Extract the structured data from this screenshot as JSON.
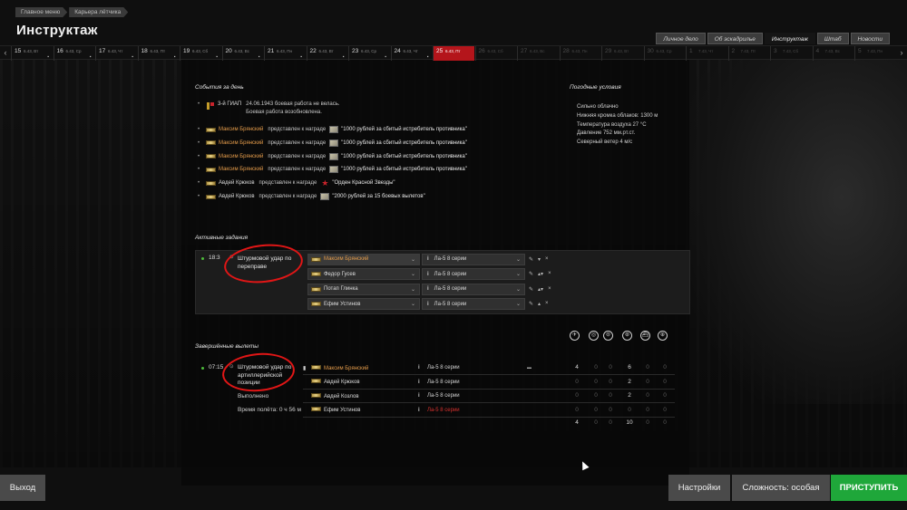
{
  "breadcrumb": [
    "Главное меню",
    "Карьера лётчика"
  ],
  "title": "Инструктаж",
  "top_tabs": [
    {
      "label": "Личное дело",
      "active": false
    },
    {
      "label": "Об эскадрилье",
      "active": false
    },
    {
      "label": "Инструктаж",
      "active": true
    },
    {
      "label": "Штаб",
      "active": false
    },
    {
      "label": "Новости",
      "active": false
    }
  ],
  "timeline": {
    "prev_icon": "‹",
    "next_icon": "›",
    "days": [
      {
        "num": "15",
        "sub": "6.43, Вт",
        "state": "past"
      },
      {
        "num": "16",
        "sub": "6.43, Ср",
        "state": "past"
      },
      {
        "num": "17",
        "sub": "6.43, Чт",
        "state": "past"
      },
      {
        "num": "18",
        "sub": "6.43, Пт",
        "state": "past"
      },
      {
        "num": "19",
        "sub": "6.43, Сб",
        "state": "past"
      },
      {
        "num": "20",
        "sub": "6.43, Вс",
        "state": "past"
      },
      {
        "num": "21",
        "sub": "6.43, Пн",
        "state": "past"
      },
      {
        "num": "22",
        "sub": "6.43, Вт",
        "state": "past"
      },
      {
        "num": "23",
        "sub": "6.43, Ср",
        "state": "past"
      },
      {
        "num": "24",
        "sub": "6.43, Чт",
        "state": "past"
      },
      {
        "num": "25",
        "sub": "6.43, Пт",
        "state": "current"
      },
      {
        "num": "26",
        "sub": "6.43, Сб",
        "state": "future"
      },
      {
        "num": "27",
        "sub": "6.43, Вс",
        "state": "future"
      },
      {
        "num": "28",
        "sub": "6.43, Пн",
        "state": "future"
      },
      {
        "num": "29",
        "sub": "6.43, Вт",
        "state": "future"
      },
      {
        "num": "30",
        "sub": "6.43, Ср",
        "state": "future"
      },
      {
        "num": "1",
        "sub": "7.43, Чт",
        "state": "future"
      },
      {
        "num": "2",
        "sub": "7.43, Пт",
        "state": "future"
      },
      {
        "num": "3",
        "sub": "7.43, Сб",
        "state": "future"
      },
      {
        "num": "4",
        "sub": "7.43, Вс",
        "state": "future"
      },
      {
        "num": "5",
        "sub": "7.43, Пн",
        "state": "future"
      }
    ]
  },
  "events": {
    "title": "События за день",
    "unit_event": {
      "unit": "3-й ГИАП",
      "line1": "24.06.1943 боевая работа не велась.",
      "line2": "Боевая работа возобновлена."
    },
    "items": [
      {
        "name": "Максим Брянский",
        "highlight": true,
        "action": "представлен к награде",
        "award": "\"1000 рублей за сбитый истребитель противника\"",
        "icon": "money"
      },
      {
        "name": "Максим Брянский",
        "highlight": true,
        "action": "представлен к награде",
        "award": "\"1000 рублей за сбитый истребитель противника\"",
        "icon": "money"
      },
      {
        "name": "Максим Брянский",
        "highlight": true,
        "action": "представлен к награде",
        "award": "\"1000 рублей за сбитый истребитель противника\"",
        "icon": "money"
      },
      {
        "name": "Максим Брянский",
        "highlight": true,
        "action": "представлен к награде",
        "award": "\"1000 рублей за сбитый истребитель противника\"",
        "icon": "money"
      },
      {
        "name": "Авдей Крюков",
        "highlight": false,
        "action": "представлен к награде",
        "award": "\"Орден Красной Звезды\"",
        "icon": "star"
      },
      {
        "name": "Авдей Крюков",
        "highlight": false,
        "action": "представлен к награде",
        "award": "\"2000 рублей за 15 боевых вылетов\"",
        "icon": "money"
      }
    ]
  },
  "weather": {
    "title": "Погодные условия",
    "lines": [
      "Сильно облачно",
      "Нижняя кромка облаков: 1300 м",
      "Температура воздуха 27 °С",
      "Давление 752 мм.рт.ст.",
      "Северный ветер 4 м/с"
    ]
  },
  "active_tasks": {
    "title": "Активные задания",
    "time": "18:3",
    "task_name": "Штурмовой удар по переправе",
    "pilots": [
      {
        "name": "Максим Брянский",
        "plane": "Ла-5 8 серии",
        "highlight": true
      },
      {
        "name": "Федор Гусев",
        "plane": "Ла-5 8 серии",
        "highlight": false
      },
      {
        "name": "Потап Глинка",
        "plane": "Ла-5 8 серии",
        "highlight": false
      },
      {
        "name": "Ефим Устинов",
        "plane": "Ла-5 8 серии",
        "highlight": false
      }
    ]
  },
  "completed": {
    "title": "Завершённые вылеты",
    "time": "07:15",
    "task_name": "Штурмовой удар по артиллерийской позиции",
    "status": "Выполнено",
    "flight_time": "Время полёта: 0 ч 56 м",
    "stat_icons": [
      "plane-kills-icon",
      "tank-icon",
      "vehicle-icon",
      "gun-icon",
      "ship-icon",
      "target-icon"
    ],
    "pilots": [
      {
        "name": "Максим Брянский",
        "plane": "Ла-5 8 серии",
        "highlight": true,
        "plane_red": false,
        "stats": [
          "4",
          "0",
          "0",
          "6",
          "0",
          "0"
        ]
      },
      {
        "name": "Авдей Крюков",
        "plane": "Ла-5 8 серии",
        "highlight": false,
        "plane_red": false,
        "stats": [
          "0",
          "0",
          "0",
          "2",
          "0",
          "0"
        ]
      },
      {
        "name": "Авдей Козлов",
        "plane": "Ла-5 8 серии",
        "highlight": false,
        "plane_red": false,
        "stats": [
          "0",
          "0",
          "0",
          "2",
          "0",
          "0"
        ]
      },
      {
        "name": "Ефим Устинов",
        "plane": "Ла-5 8 серии",
        "highlight": false,
        "plane_red": true,
        "stats": [
          "0",
          "0",
          "0",
          "0",
          "0",
          "0"
        ]
      }
    ],
    "totals": [
      "4",
      "0",
      "0",
      "10",
      "0",
      "0"
    ]
  },
  "buttons": {
    "exit": "Выход",
    "settings": "Настройки",
    "difficulty": "Сложность: особая",
    "start": "ПРИСТУПИТЬ"
  },
  "colors": {
    "accent_red": "#b4151b",
    "start_green": "#1fa73a",
    "name_orange": "#e39b4a",
    "annotation_red": "#e11616"
  }
}
